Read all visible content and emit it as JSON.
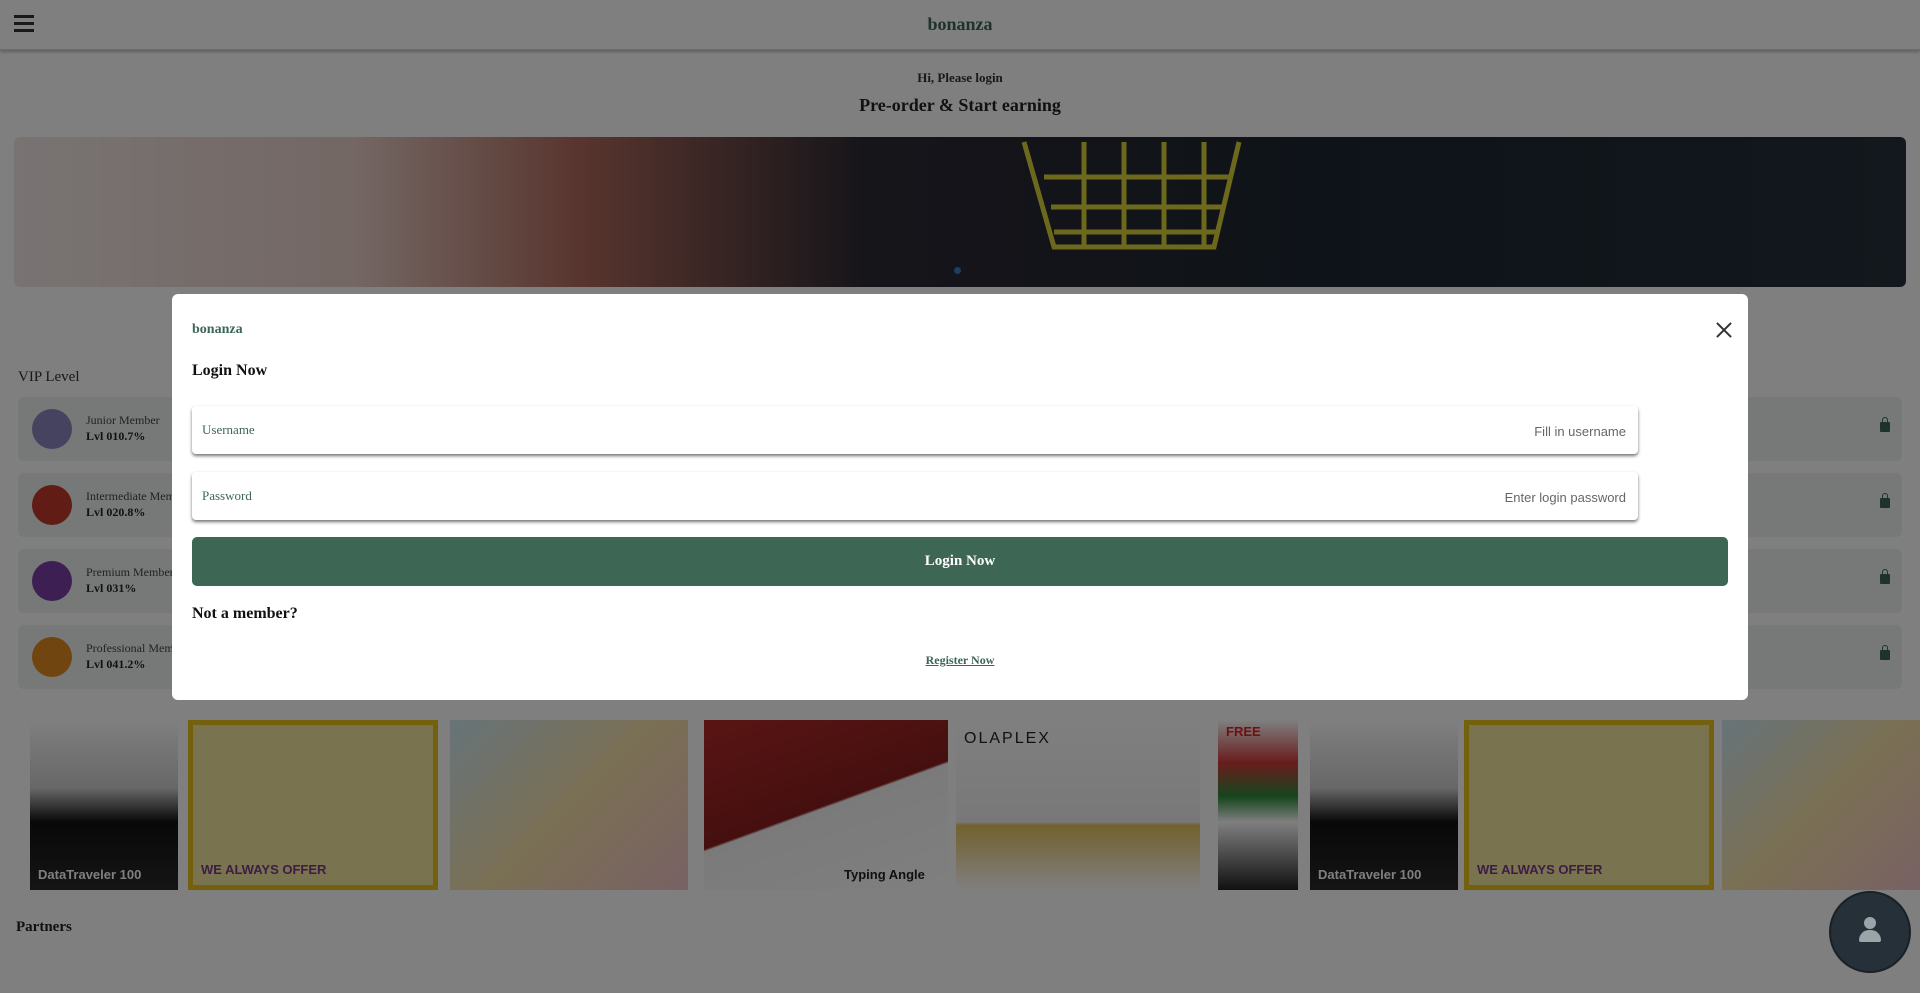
{
  "header": {
    "logo": "bonanza"
  },
  "hero": {
    "greeting": "Hi, Please login",
    "headline": "Pre-order & Start earning"
  },
  "vip": {
    "title": "VIP Level",
    "levels": [
      {
        "name": "Junior Member",
        "level": "Lvl 01⁠0.7%",
        "badge_color": "#8b86c0"
      },
      {
        "name": "Intermediate Mem",
        "level": "Lvl 02⁠0.8%",
        "badge_color": "#c0392b"
      },
      {
        "name": "Premium Member",
        "level": "Lvl 03⁠1%",
        "badge_color": "#7b3fa8"
      },
      {
        "name": "Professional Mem",
        "level": "Lvl 04⁠1.2%",
        "badge_color": "#e08a1e"
      }
    ]
  },
  "products": [
    {
      "text": "DataTraveler 100"
    },
    {
      "text": "WE ALWAYS OFFER"
    },
    {
      "text": ""
    },
    {
      "text": "Typing Angle"
    },
    {
      "text": "OLAPLEX"
    },
    {
      "text": "FREE"
    },
    {
      "text": "DataTraveler 100"
    },
    {
      "text": "WE ALWAYS OFFER"
    }
  ],
  "partners": {
    "title": "Partners"
  },
  "modal": {
    "logo": "bonanza",
    "title": "Login Now",
    "username_label": "Username",
    "username_placeholder": "Fill in username",
    "password_label": "Password",
    "password_placeholder": "Enter login password",
    "login_button": "Login Now",
    "not_member": "Not a member?",
    "register_link": "Register Now"
  },
  "colors": {
    "brand": "#3d6655",
    "overlay": "rgba(0,0,0,0.5)"
  }
}
